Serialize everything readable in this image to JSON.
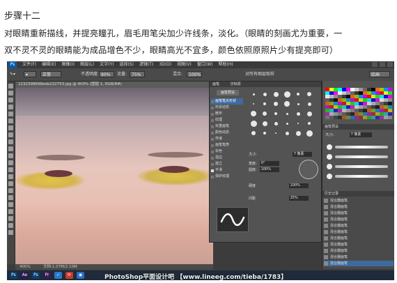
{
  "caption": {
    "title": "步骤十二",
    "line1": "对眼睛重新描线，并提亮瞳孔，眉毛用笔尖加少许线条，淡化。（眼睛的刻画尤为重要，一",
    "line2": "双不灵不灵的眼睛能为成品增色不少，眼睛高光不宜多，颜色依照原照片少有提亮即可）"
  },
  "app": {
    "logo": "Ps",
    "menu": [
      "文件(F)",
      "编辑(E)",
      "图像(I)",
      "图层(L)",
      "文字(Y)",
      "选择(S)",
      "滤镜(T)",
      "3D(D)",
      "视图(V)",
      "窗口(W)",
      "帮助(H)"
    ]
  },
  "options": {
    "mode_value": "正常",
    "opacity_label": "不透明度:",
    "opacity_value": "90%",
    "flow_label": "流量:",
    "flow_value": "75%",
    "mix_value": "混合:",
    "mix_pct": "100%",
    "sample_label": "对所有图层取样",
    "workspace": "绘画"
  },
  "document": {
    "tab_title": "1232398698ede222753.jpg @ 400% (图层 1, RGB/8#)",
    "zoom": "400%",
    "doc_size": "文档:1.07M/2.10M"
  },
  "brush_panel": {
    "tabs": [
      "画笔",
      "仿制源"
    ],
    "preset_button": "画笔预设",
    "options": [
      {
        "label": "画笔笔尖形状",
        "selected": true,
        "checked": false
      },
      {
        "label": "形状动态",
        "selected": false,
        "checked": false
      },
      {
        "label": "散布",
        "selected": false,
        "checked": false
      },
      {
        "label": "纹理",
        "selected": false,
        "checked": false
      },
      {
        "label": "双重画笔",
        "selected": false,
        "checked": false
      },
      {
        "label": "颜色动态",
        "selected": false,
        "checked": false
      },
      {
        "label": "传递",
        "selected": false,
        "checked": false
      },
      {
        "label": "画笔笔势",
        "selected": false,
        "checked": false
      },
      {
        "label": "杂色",
        "selected": false,
        "checked": false
      },
      {
        "label": "湿边",
        "selected": false,
        "checked": false
      },
      {
        "label": "建立",
        "selected": false,
        "checked": false
      },
      {
        "label": "平滑",
        "selected": false,
        "checked": true
      },
      {
        "label": "保护纹理",
        "selected": false,
        "checked": false
      }
    ],
    "size_label": "大小",
    "size_value": "7 像素",
    "angle_label": "角度:",
    "angle_value": "0°",
    "roundness_label": "圆度:",
    "roundness_value": "100%",
    "hardness_label": "硬度",
    "hardness_value": "100%",
    "spacing_label": "间距",
    "spacing_value": "25%"
  },
  "right_panel": {
    "tabs": "画笔预设",
    "size_label": "大小:",
    "size_value": "7 像素",
    "history_tabs": "历史记录",
    "history": [
      "混合器画笔",
      "混合器画笔",
      "混合器画笔",
      "混合器画笔",
      "混合器画笔",
      "混合器画笔",
      "混合器画笔",
      "混合器画笔",
      "混合器画笔",
      "混合器画笔",
      "混合器画笔"
    ]
  },
  "taskbar": {
    "icons": [
      {
        "name": "Ps",
        "color": "#0a3d6e"
      },
      {
        "name": "Ae",
        "color": "#2a1a4f"
      },
      {
        "name": "Ps",
        "color": "#0a3d6e"
      },
      {
        "name": "Pr",
        "color": "#3a1a4f"
      },
      {
        "name": "✓",
        "color": "#2a78c8"
      },
      {
        "name": "⟳",
        "color": "#c83a2a"
      },
      {
        "name": "◉",
        "color": "#2a6ec8"
      }
    ],
    "watermark": "PhotoShop平面设计吧 【www.lineeg.com/tieba/1783】"
  },
  "colors": {
    "swatches": [
      "#ff0000",
      "#ffff00",
      "#00ff00",
      "#00ffff",
      "#0000ff",
      "#ff00ff",
      "#ffffff",
      "#cccccc",
      "#999999",
      "#666666",
      "#333333",
      "#000000",
      "#ff6600",
      "#99cc00",
      "#0099ff",
      "#cc00ff"
    ]
  }
}
